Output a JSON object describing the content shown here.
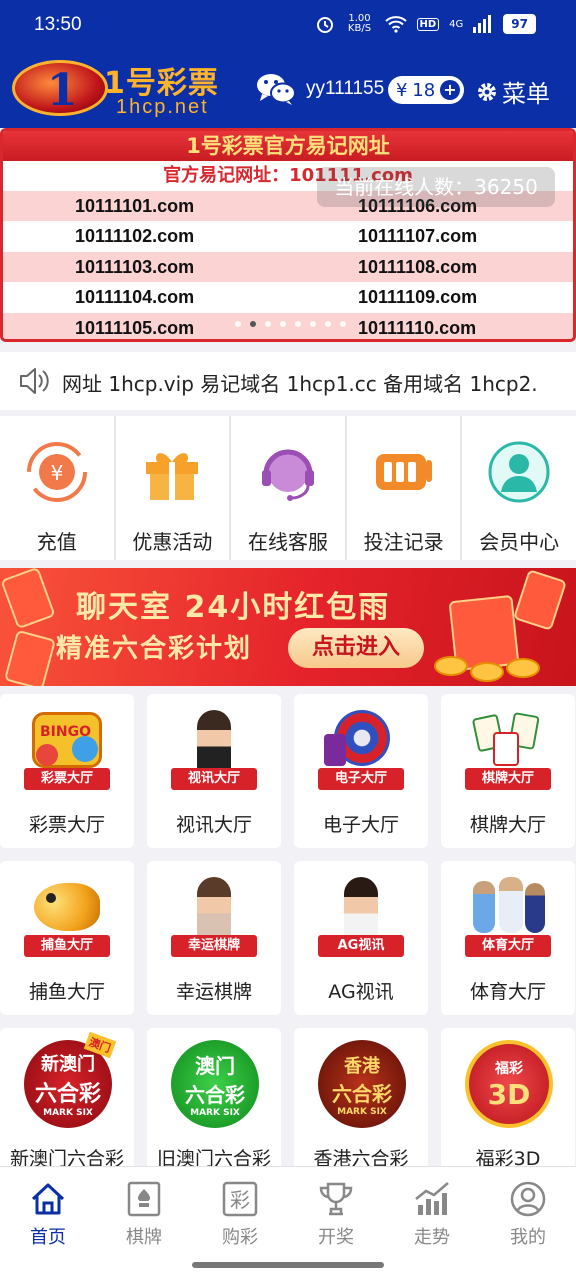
{
  "status_bar": {
    "time": "13:50",
    "net_speed": "1.00 KB/S",
    "hd": "HD",
    "signal": "4G",
    "battery": "97"
  },
  "header": {
    "logo_text": "1号彩票",
    "logo_sub": "1hcp.net",
    "username": "yy111155",
    "balance_currency": "¥",
    "balance": "18",
    "menu_label": "菜单"
  },
  "banner": {
    "title": "1号彩票官方易记网址",
    "subtitle": "官方易记网址：101111.com",
    "online_users": "当前在线人数：36250",
    "domains_left": [
      "10111101.com",
      "10111102.com",
      "10111103.com",
      "10111104.com",
      "10111105.com"
    ],
    "domains_right": [
      "10111106.com",
      "10111107.com",
      "10111108.com",
      "10111109.com",
      "10111110.com"
    ],
    "page_count": 8,
    "active_page": 2
  },
  "notice": {
    "text": "网址 1hcp.vip 易记域名 1hcp1.cc 备用域名 1hcp2."
  },
  "quick_actions": [
    {
      "label": "充值",
      "icon": "recharge-icon"
    },
    {
      "label": "优惠活动",
      "icon": "gift-icon"
    },
    {
      "label": "在线客服",
      "icon": "customer-service-icon"
    },
    {
      "label": "投注记录",
      "icon": "bet-record-icon"
    },
    {
      "label": "会员中心",
      "icon": "member-icon"
    }
  ],
  "promo": {
    "line1": "聊天室 24小时红包雨",
    "line2": "精准六合彩计划",
    "button": "点击进入"
  },
  "games": [
    {
      "name": "彩票大厅",
      "ribbon": "彩票大厅",
      "icon": "bingo-icon"
    },
    {
      "name": "视讯大厅",
      "ribbon": "视讯大厅",
      "icon": "live-dealer-icon"
    },
    {
      "name": "电子大厅",
      "ribbon": "电子大厅",
      "icon": "slots-icon"
    },
    {
      "name": "棋牌大厅",
      "ribbon": "棋牌大厅",
      "icon": "mahjong-icon"
    },
    {
      "name": "捕鱼大厅",
      "ribbon": "捕鱼大厅",
      "icon": "fish-icon"
    },
    {
      "name": "幸运棋牌",
      "ribbon": "幸运棋牌",
      "icon": "lucky-cards-icon"
    },
    {
      "name": "AG视讯",
      "ribbon": "AG视讯",
      "icon": "ag-live-icon"
    },
    {
      "name": "体育大厅",
      "ribbon": "体育大厅",
      "icon": "sports-icon"
    },
    {
      "name": "新澳门六合彩",
      "badge_l1": "新澳门",
      "badge_l2": "六合彩",
      "badge_l3": "MARK SIX",
      "corner": "澳门"
    },
    {
      "name": "旧澳门六合彩",
      "badge_l1": "澳门",
      "badge_l2": "六合彩",
      "badge_l3": "MARK SIX"
    },
    {
      "name": "香港六合彩",
      "badge_l1": "香港",
      "badge_l2": "六合彩",
      "badge_l3": "MARK SIX"
    },
    {
      "name": "福彩3D",
      "badge_l1": "福彩",
      "badge_l2": "3D"
    }
  ],
  "tabbar": [
    {
      "label": "首页",
      "icon": "home-icon",
      "active": true
    },
    {
      "label": "棋牌",
      "icon": "chess-icon"
    },
    {
      "label": "购彩",
      "icon": "lottery-icon"
    },
    {
      "label": "开奖",
      "icon": "trophy-icon"
    },
    {
      "label": "走势",
      "icon": "trend-icon"
    },
    {
      "label": "我的",
      "icon": "profile-icon"
    }
  ],
  "colors": {
    "brand": "#0b2fa6",
    "accent": "#d9272e",
    "gold": "#ffb32c"
  }
}
